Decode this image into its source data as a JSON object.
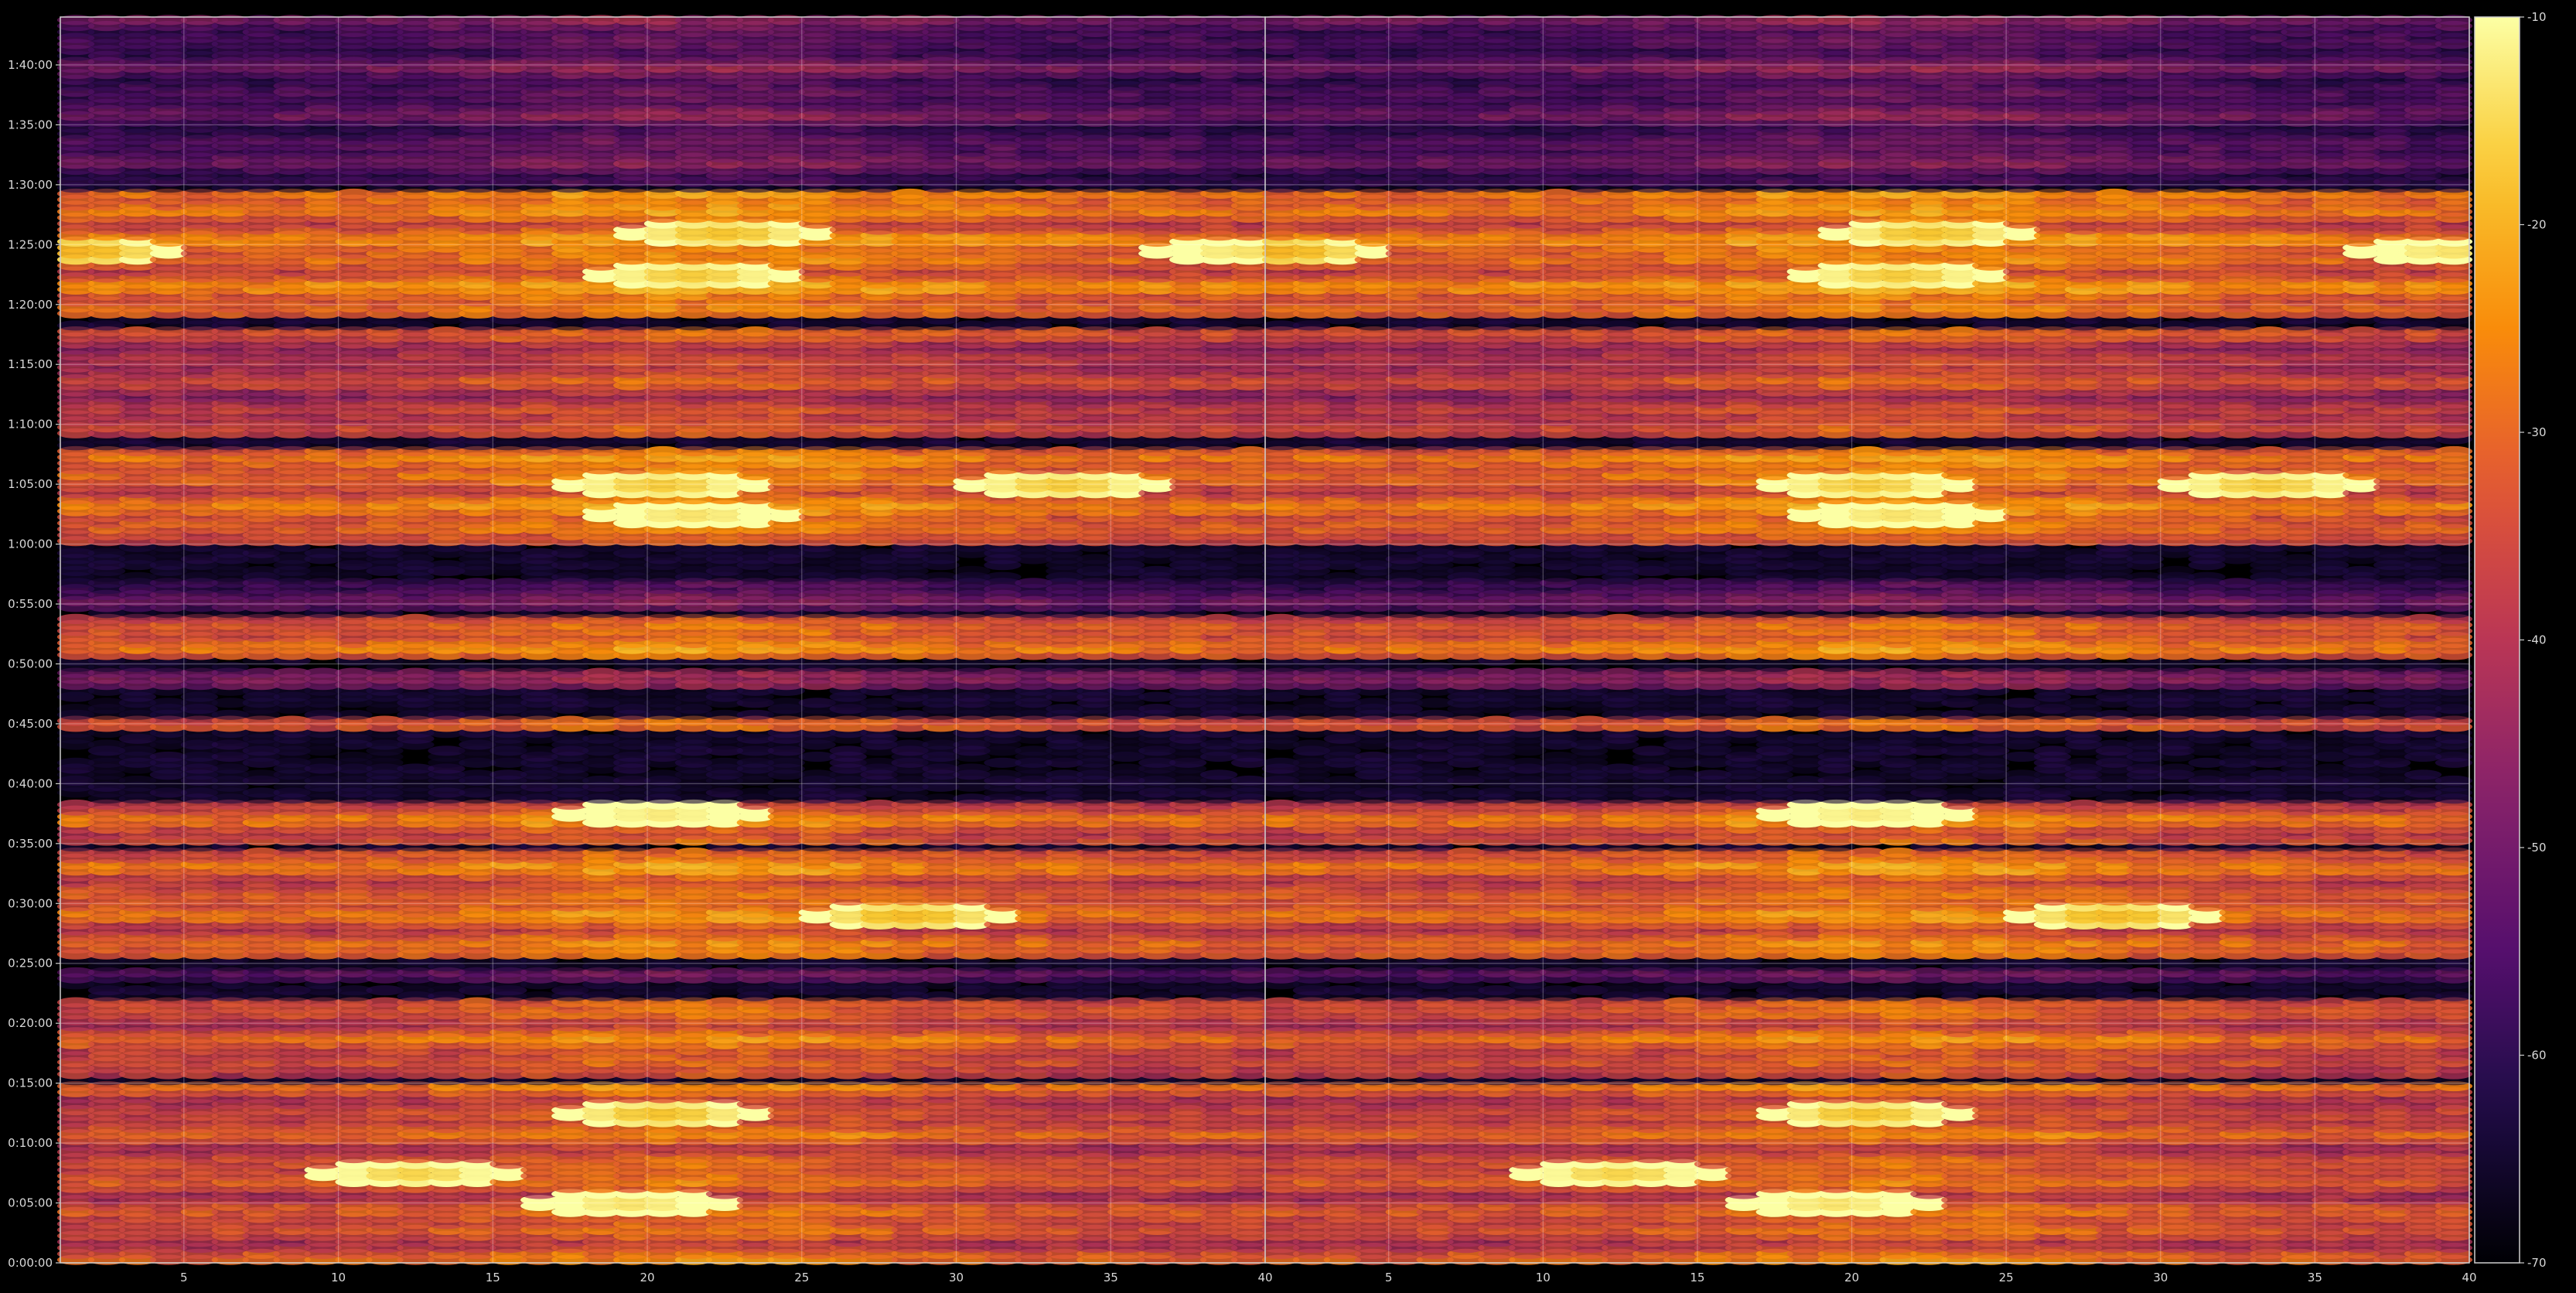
{
  "chart_data": {
    "type": "heatmap",
    "title": "",
    "xlabel": "",
    "ylabel": "",
    "colormap": "inferno",
    "background": "#000000",
    "panels": [
      {
        "name": "",
        "x_range": [
          1,
          40
        ],
        "x_ticks": [
          "5",
          "10",
          "15",
          "20",
          "25",
          "30",
          "35",
          "40"
        ]
      },
      {
        "name": "",
        "x_range": [
          40,
          79
        ],
        "x_ticks": [
          "5",
          "10",
          "15",
          "20",
          "25",
          "30",
          "35",
          "40"
        ]
      }
    ],
    "y_range_seconds": [
      0,
      6240
    ],
    "y_ticks": [
      "0:00:00",
      "0:05:00",
      "0:10:00",
      "0:15:00",
      "0:20:00",
      "0:25:00",
      "0:30:00",
      "0:35:00",
      "0:40:00",
      "0:45:00",
      "0:50:00",
      "0:55:00",
      "1:00:00",
      "1:05:00",
      "1:10:00",
      "1:15:00",
      "1:20:00",
      "1:25:00",
      "1:30:00",
      "1:35:00",
      "1:40:00"
    ],
    "colorbar": {
      "min": -70,
      "max": -10,
      "ticks": [
        "-10",
        "-20",
        "-30",
        "-40",
        "-50",
        "-60",
        "-70"
      ]
    },
    "active_bands_minutes": [
      {
        "start": 0.0,
        "end": 15.0,
        "level": -36
      },
      {
        "start": 15.5,
        "end": 22.0,
        "level": -35
      },
      {
        "start": 23.5,
        "end": 24.5,
        "level": -50
      },
      {
        "start": 25.5,
        "end": 34.5,
        "level": -33
      },
      {
        "start": 35.0,
        "end": 38.5,
        "level": -34
      },
      {
        "start": 44.5,
        "end": 45.5,
        "level": -38
      },
      {
        "start": 48.0,
        "end": 49.5,
        "level": -50
      },
      {
        "start": 50.5,
        "end": 54.0,
        "level": -33
      },
      {
        "start": 54.5,
        "end": 57.0,
        "level": -56
      },
      {
        "start": 60.0,
        "end": 68.0,
        "level": -32
      },
      {
        "start": 69.0,
        "end": 78.0,
        "level": -40
      },
      {
        "start": 79.0,
        "end": 89.5,
        "level": -31
      },
      {
        "start": 90.0,
        "end": 104.0,
        "level": -55
      }
    ],
    "hotspots": [
      {
        "x": 19,
        "minute": 5.0,
        "level": -14
      },
      {
        "x": 12,
        "minute": 7.5,
        "level": -16
      },
      {
        "x": 20,
        "minute": 12.5,
        "level": -18
      },
      {
        "x": 20,
        "minute": 37.5,
        "level": -13
      },
      {
        "x": 28,
        "minute": 29.0,
        "level": -19
      },
      {
        "x": 21,
        "minute": 62.5,
        "level": -14
      },
      {
        "x": 20,
        "minute": 65.0,
        "level": -17
      },
      {
        "x": 33,
        "minute": 65.0,
        "level": -17
      },
      {
        "x": 21,
        "minute": 82.5,
        "level": -17
      },
      {
        "x": 22,
        "minute": 86.0,
        "level": -18
      },
      {
        "x": 39,
        "minute": 84.5,
        "level": -14
      },
      {
        "x": 1,
        "minute": 84.5,
        "level": -20
      }
    ]
  }
}
